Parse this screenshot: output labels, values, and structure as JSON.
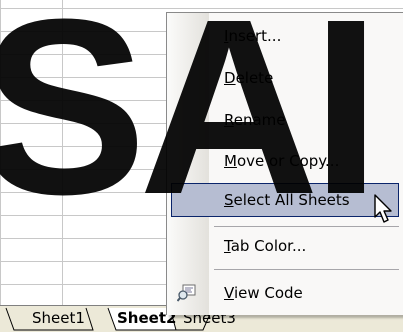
{
  "menu": {
    "items": [
      {
        "before": "",
        "key": "I",
        "after": "nsert..."
      },
      {
        "before": "",
        "key": "D",
        "after": "elete"
      },
      {
        "before": "",
        "key": "R",
        "after": "ename"
      },
      {
        "before": "",
        "key": "M",
        "after": "ove or Copy..."
      },
      {
        "before": "",
        "key": "S",
        "after": "elect All Sheets"
      },
      {
        "before": "",
        "key": "T",
        "after": "ab Color..."
      },
      {
        "before": "",
        "key": "V",
        "after": "iew Code"
      }
    ],
    "selected_index": 4,
    "selected_color": "#b6bdd2",
    "selected_border": "#0a246a"
  },
  "watermark": "SAI",
  "tabs": {
    "items": [
      {
        "label": "Sheet1"
      },
      {
        "label": "Sheet2"
      },
      {
        "label": "Sheet3"
      }
    ],
    "active_index": 1
  },
  "icons": {
    "view_code": "view-code-icon",
    "cursor": "mouse-pointer"
  }
}
